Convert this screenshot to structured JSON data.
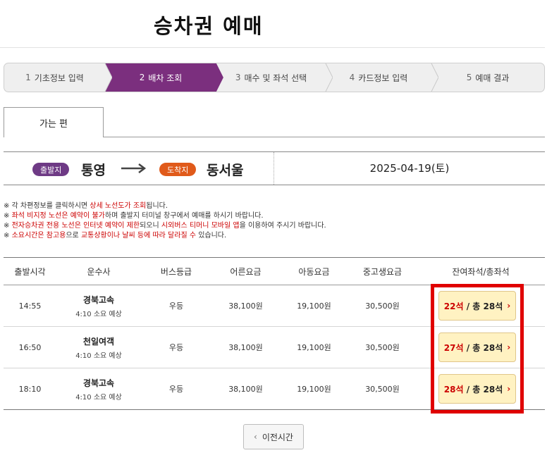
{
  "page": {
    "title": "승차권 예매"
  },
  "stepper": {
    "steps": [
      {
        "num": "1",
        "label": "기초정보 입력"
      },
      {
        "num": "2",
        "label": "배차 조회"
      },
      {
        "num": "3",
        "label": "매수 및 좌석 선택"
      },
      {
        "num": "4",
        "label": "카드정보 입력"
      },
      {
        "num": "5",
        "label": "예매 결과"
      }
    ],
    "active_index": 1,
    "active_color": "#7b2f7e"
  },
  "tab": {
    "label": "가는 편"
  },
  "route": {
    "departure_badge": "출발지",
    "departure_city": "통영",
    "arrival_badge": "도착지",
    "arrival_city": "동서울",
    "date": "2025-04-19(토)",
    "departure_color": "#6e3a85",
    "arrival_color": "#e05a1a"
  },
  "notices": [
    {
      "parts": [
        "※ 각 차편정보를 클릭하시면 ",
        "상세 노선도가 조회",
        "됩니다."
      ]
    },
    {
      "parts": [
        "※ ",
        "좌석 비지정 노선은 예약이 불가",
        "하며 출발지 터미널 창구에서 예매를 하시기 바랍니다."
      ]
    },
    {
      "parts": [
        "※ ",
        "전자승차권 전용 노선은 인터넷 예약이 제한",
        "되오니 ",
        "시외버스 티머니 모바일 앱",
        "을 이용하여 주시기 바랍니다."
      ]
    },
    {
      "parts": [
        "※ ",
        "소요시간은 참고용",
        "으로 ",
        "교통상황이나 날씨 등에 따라 달라질 수",
        " 있습니다."
      ]
    }
  ],
  "table": {
    "headers": [
      "출발시각",
      "운수사",
      "버스등급",
      "어른요금",
      "아동요금",
      "중고생요금",
      "잔여좌석/총좌석"
    ],
    "rows": [
      {
        "time": "14:55",
        "company": "경북고속",
        "duration": "4:10 소요 예상",
        "grade": "우등",
        "adult": "38,100원",
        "child": "19,100원",
        "youth": "30,500원",
        "remaining": "22석",
        "total": "/ 총 28석"
      },
      {
        "time": "16:50",
        "company": "천일여객",
        "duration": "4:10 소요 예상",
        "grade": "우등",
        "adult": "38,100원",
        "child": "19,100원",
        "youth": "30,500원",
        "remaining": "27석",
        "total": "/ 총 28석"
      },
      {
        "time": "18:10",
        "company": "경북고속",
        "duration": "4:10 소요 예상",
        "grade": "우등",
        "adult": "38,100원",
        "child": "19,100원",
        "youth": "30,500원",
        "remaining": "28석",
        "total": "/ 총 28석"
      }
    ]
  },
  "footer": {
    "prev_label": "이전시간"
  },
  "colors": {
    "highlight": "#e00000",
    "seat_button_bg": "#fff2c2",
    "seat_remaining": "#cc0000"
  }
}
